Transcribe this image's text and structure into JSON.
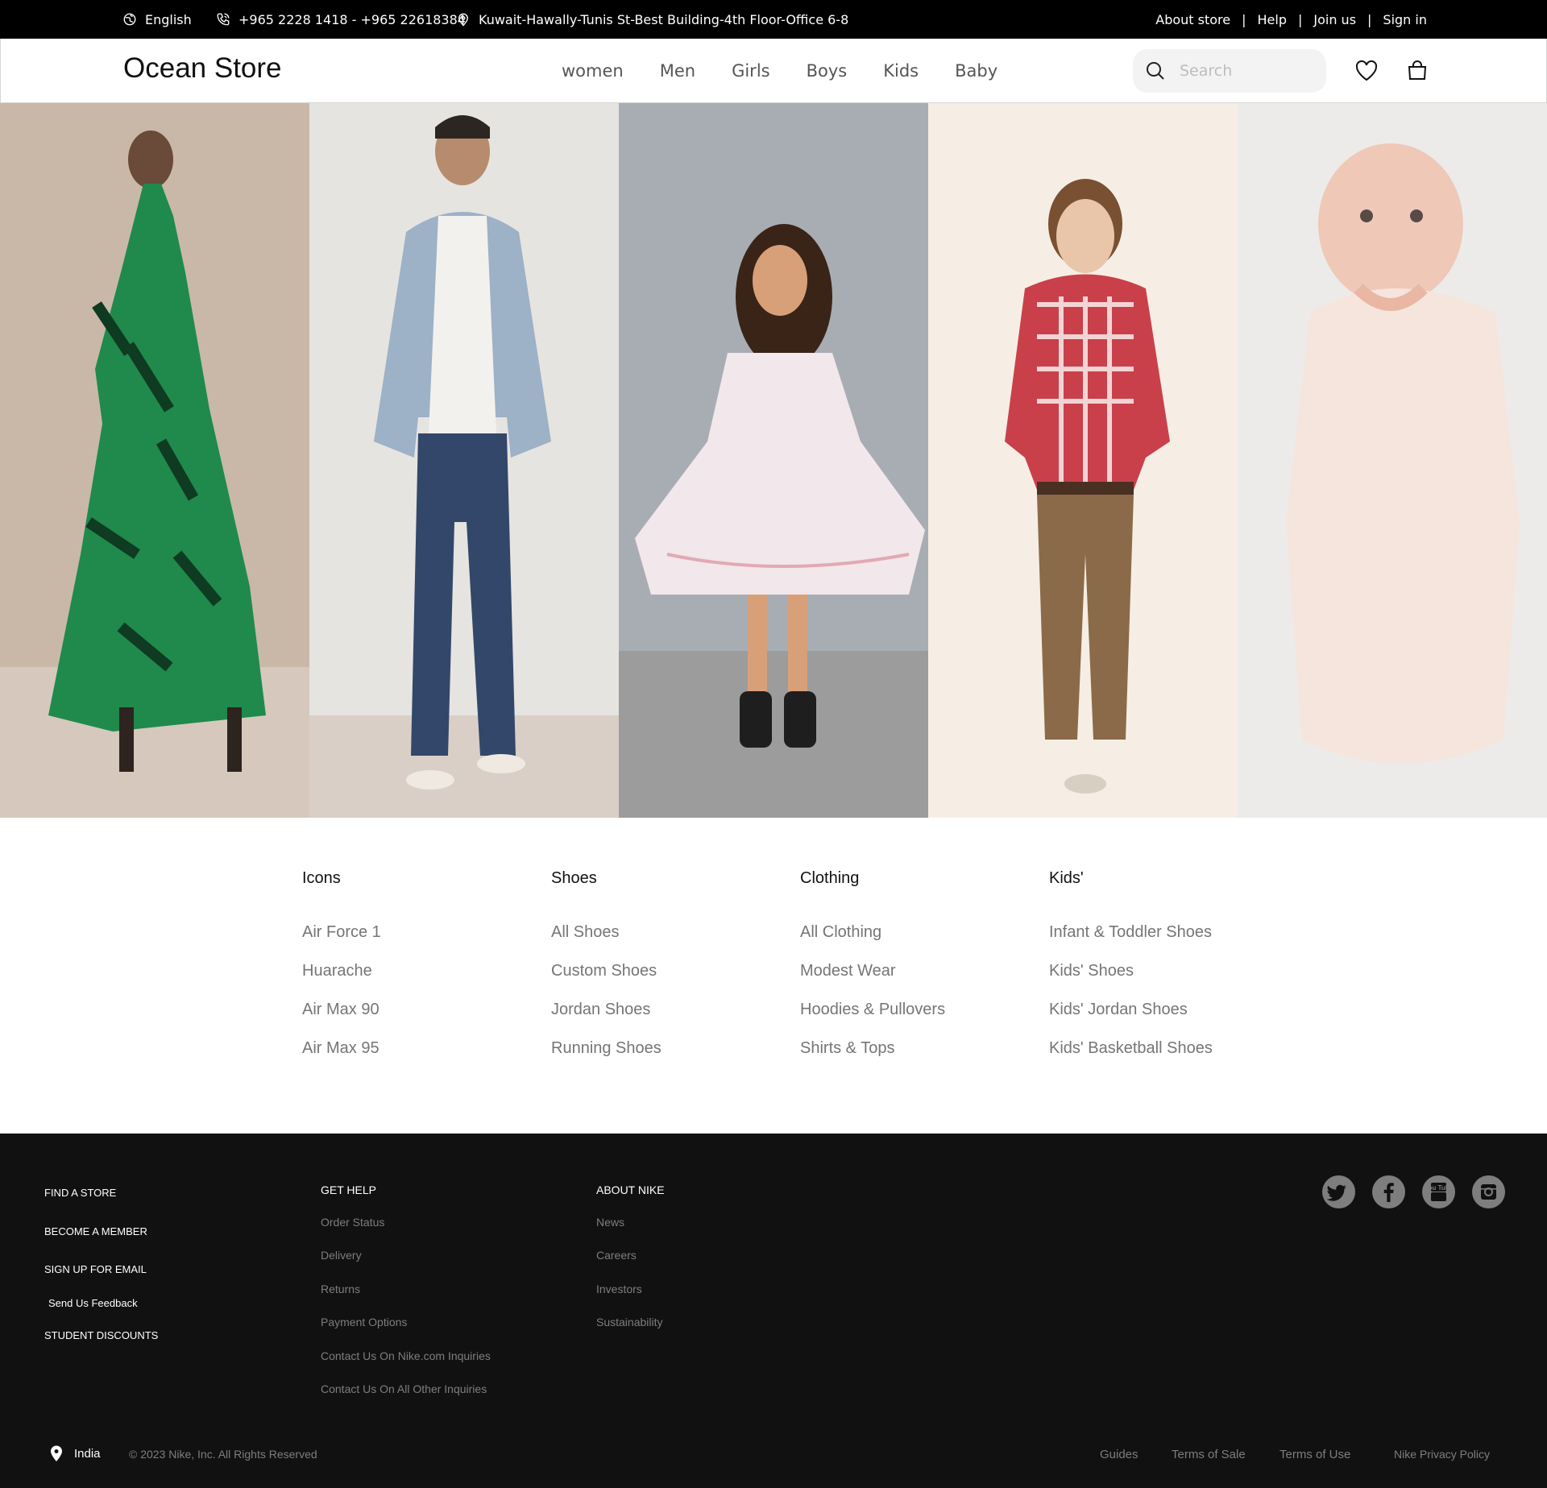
{
  "topbar": {
    "language": "English",
    "phones": "+965 2228 1418 - +965 22618384",
    "address": "Kuwait-Hawally-Tunis St-Best Building-4th Floor-Office 6-8",
    "links": [
      "About store",
      "Help",
      "Join us",
      "Sign in"
    ]
  },
  "header": {
    "logo": "Ocean Store",
    "nav": [
      "women",
      "Men",
      "Girls",
      "Boys",
      "Kids",
      "Baby"
    ],
    "search_placeholder": "Search"
  },
  "hero": {
    "panels": [
      "women",
      "men",
      "girls",
      "boys",
      "baby"
    ],
    "colors": {
      "women_bg": "#c9b8a8",
      "men_bg": "#e6e4e0",
      "girls_bg": "#a8adb4",
      "boys_bg": "#f6eee4",
      "baby_bg": "#ecebe9"
    }
  },
  "categories": [
    {
      "title": "Icons",
      "items": [
        "Air Force 1",
        "Huarache",
        "Air Max 90",
        "Air Max 95"
      ]
    },
    {
      "title": "Shoes",
      "items": [
        "All Shoes",
        "Custom Shoes",
        "Jordan Shoes",
        "Running Shoes"
      ]
    },
    {
      "title": "Clothing",
      "items": [
        "All Clothing",
        "Modest Wear",
        "Hoodies & Pullovers",
        "Shirts & Tops"
      ]
    },
    {
      "title": "Kids'",
      "items": [
        "Infant & Toddler Shoes",
        "Kids' Shoes",
        "Kids' Jordan Shoes",
        "Kids' Basketball Shoes"
      ]
    }
  ],
  "footer": {
    "primary_links": [
      "FIND A STORE",
      "BECOME A MEMBER",
      "SIGN UP FOR EMAIL",
      "Send Us Feedback",
      "STUDENT DISCOUNTS"
    ],
    "get_help": {
      "title": "GET HELP",
      "items": [
        "Order Status",
        "Delivery",
        "Returns",
        "Payment Options",
        "Contact Us On Nike.com Inquiries",
        "Contact Us On All Other Inquiries"
      ]
    },
    "about": {
      "title": "ABOUT NIKE",
      "items": [
        "News",
        "Careers",
        "Investors",
        "Sustainability"
      ]
    },
    "social": [
      "twitter-icon",
      "facebook-icon",
      "youtube-icon",
      "instagram-icon"
    ],
    "social_labels": {
      "youtube": "You Tube"
    },
    "location": "India",
    "copyright": "© 2023 Nike, Inc. All Rights Reserved",
    "legal": [
      "Guides",
      "Terms of Sale",
      "Terms of Use",
      "Nike Privacy Policy"
    ]
  }
}
